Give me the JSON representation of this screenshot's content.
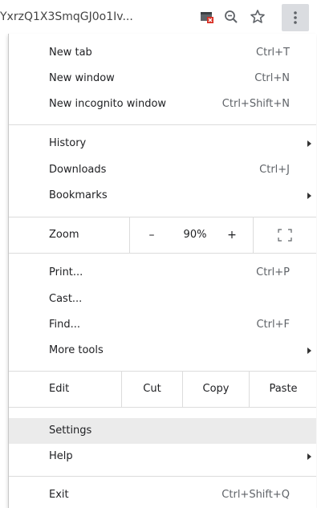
{
  "omnibox": {
    "url_fragment": "YxrzQ1X3SmqGJ0o1Iv..."
  },
  "toolbar_icons": [
    "cast-blocked-icon",
    "zoom-icon",
    "star-icon",
    "menu-kebab-icon"
  ],
  "menu": {
    "group1": [
      {
        "label": "New tab",
        "shortcut": "Ctrl+T"
      },
      {
        "label": "New window",
        "shortcut": "Ctrl+N"
      },
      {
        "label": "New incognito window",
        "shortcut": "Ctrl+Shift+N"
      }
    ],
    "group2": [
      {
        "label": "History",
        "submenu": true
      },
      {
        "label": "Downloads",
        "shortcut": "Ctrl+J"
      },
      {
        "label": "Bookmarks",
        "submenu": true
      }
    ],
    "zoom": {
      "label": "Zoom",
      "minus": "–",
      "level": "90%",
      "plus": "+",
      "fullscreen_icon": "fullscreen-icon"
    },
    "group3": [
      {
        "label": "Print...",
        "shortcut": "Ctrl+P"
      },
      {
        "label": "Cast..."
      },
      {
        "label": "Find...",
        "shortcut": "Ctrl+F"
      },
      {
        "label": "More tools",
        "submenu": true
      }
    ],
    "edit": {
      "label": "Edit",
      "cut": "Cut",
      "copy": "Copy",
      "paste": "Paste"
    },
    "group4": [
      {
        "label": "Settings",
        "highlighted": true
      },
      {
        "label": "Help",
        "submenu": true
      }
    ],
    "exit": {
      "label": "Exit",
      "shortcut": "Ctrl+Shift+Q"
    }
  }
}
